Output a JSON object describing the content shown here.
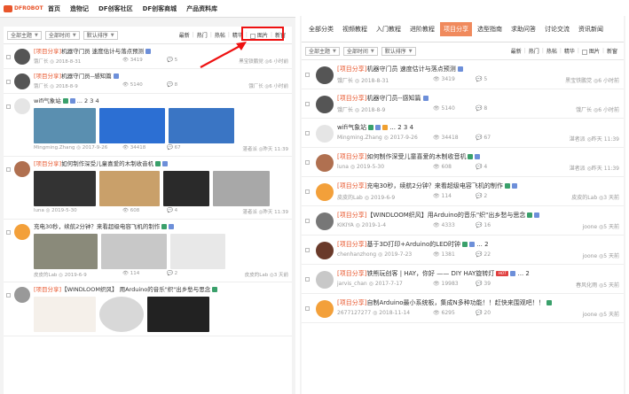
{
  "top_nav": {
    "logo": "DFROBOT",
    "items": [
      "首页",
      "造物记",
      "DF创客社区",
      "DF创客商城",
      "产品资料库"
    ]
  },
  "filters": {
    "left": [
      "全部主题",
      "全部时间",
      "默认排序"
    ],
    "links": [
      "最新",
      "热门",
      "热帖",
      "精华",
      "图片",
      "新窗"
    ],
    "right": [
      "全部主题",
      "全部时间",
      "默认排序"
    ]
  },
  "left_posts": [
    {
      "tag": "[项目分享]",
      "title": "机器守门员 速度估计与落点预测",
      "author": "饿厂长",
      "date": "2018-8-31",
      "views": "3419",
      "replies": "5",
      "last": "黑宝铁鹏党 ◎6 小时前"
    },
    {
      "tag": "[项目分享]",
      "title": "机器守门员--感知篇",
      "author": "饿厂长",
      "date": "2018-8-9",
      "views": "5140",
      "replies": "8",
      "last": "饿厂长 ◎6 小时前"
    },
    {
      "tag": "",
      "title": "wifi气象站",
      "pages": "... 2 3 4",
      "author": "Mingming.Zhang",
      "date": "2017-9-26",
      "views": "34418",
      "replies": "67",
      "last": "湛者派 ◎昨天 11:39"
    },
    {
      "tag": "[项目分享]",
      "title": "如何制作深受儿童喜爱的木制收音机",
      "author": "luna",
      "date": "2019-5-30",
      "views": "608",
      "replies": "4",
      "last": "湛者派 ◎昨天 11:39"
    },
    {
      "tag": "",
      "title": "充电30秒，续航2分钟？来看超级电容飞机的制作",
      "author": "皮皮的Lab",
      "date": "2019-6-9",
      "views": "114",
      "replies": "2",
      "last": "皮皮的Lab ◎3 天前"
    },
    {
      "tag": "[项目分享]",
      "title": "【WINDLOOM织风】 用Arduino的音乐\"织\"出乡愁与思念",
      "author": "",
      "date": "",
      "views": "",
      "replies": "",
      "last": ""
    }
  ],
  "categories": [
    "全部分类",
    "视频教程",
    "入门教程",
    "进阶教程",
    "项目分享",
    "选型指南",
    "求助问答",
    "讨论交流",
    "资讯新闻"
  ],
  "active_category": "项目分享",
  "right_posts": [
    {
      "tag": "[项目分享]",
      "title": "机器守门员 速度估计与落点预测",
      "author": "饿厂长",
      "date": "2018-8-31",
      "views": "3419",
      "replies": "5",
      "last": "黑宝铁鹏党 ◎6 小时前"
    },
    {
      "tag": "[项目分享]",
      "title": "机器守门员--感知篇",
      "author": "饿厂长",
      "date": "2018-8-9",
      "views": "5140",
      "replies": "8",
      "last": "饿厂长 ◎6 小时前"
    },
    {
      "tag": "",
      "title": "wifi气象站",
      "pages": "... 2 3 4",
      "author": "Mingming.Zhang",
      "date": "2017-9-26",
      "views": "34418",
      "replies": "67",
      "last": "湛者派 ◎昨天 11:39"
    },
    {
      "tag": "[项目分享]",
      "title": "如何制作深受儿童喜爱的木制收音机",
      "author": "luna",
      "date": "2019-5-30",
      "views": "608",
      "replies": "4",
      "last": "湛者派 ◎昨天 11:39"
    },
    {
      "tag": "[项目分享]",
      "title": "充电30秒，续航2分钟？来看超级电容飞机的制作",
      "author": "皮皮的Lab",
      "date": "2019-6-9",
      "views": "114",
      "replies": "2",
      "last": "皮皮的Lab ◎3 天前"
    },
    {
      "tag": "[项目分享]",
      "title": "【WINDLOOM织风】用Arduino的音乐\"织\"出乡愁与思念",
      "author": "KIKIYA",
      "date": "2019-1-4",
      "views": "4333",
      "replies": "16",
      "last": "joone ◎5 天前"
    },
    {
      "tag": "[项目分享]",
      "title": "基于3D打印+Arduino的LED时钟",
      "pages": "... 2",
      "author": "chenhanzhong",
      "date": "2019-7-23",
      "views": "1381",
      "replies": "22",
      "last": "joone ◎5 天前"
    },
    {
      "tag": "[项目分享]",
      "title": "铁熊玩创客 | HAY，你好 —— DIY HAY旋转灯",
      "pages": "... 2",
      "author": "jarvis_chan",
      "date": "2017-7-17",
      "views": "19983",
      "replies": "39",
      "last": "春风化雨 ◎5 天前"
    },
    {
      "tag": "[项目分享]",
      "title": "自制Arduino最小系统板，集成N多种功能！！赶快来围观吧！！",
      "author": "2677127277",
      "date": "2018-11-14",
      "views": "6295",
      "replies": "20",
      "last": "joone ◎5 天前"
    }
  ]
}
